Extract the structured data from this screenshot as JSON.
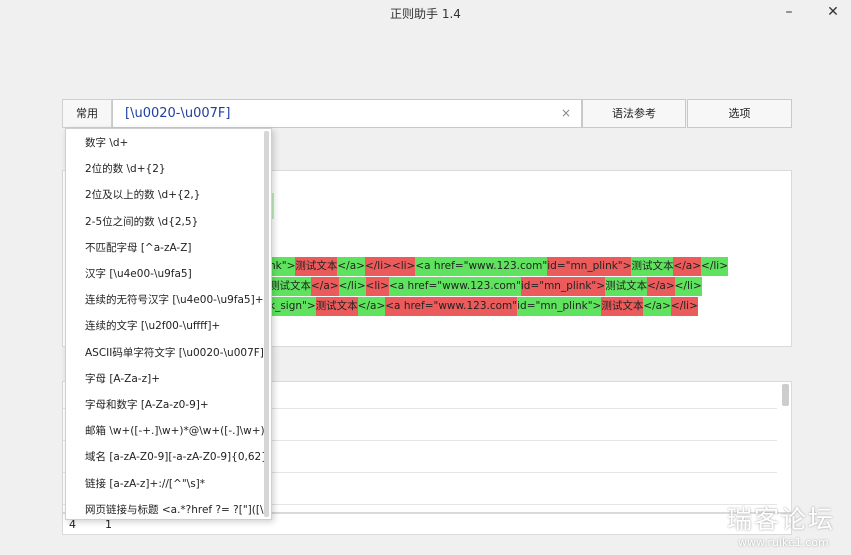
{
  "window": {
    "title": "正则助手 1.4",
    "minimize": "–",
    "close": "✕"
  },
  "toolbar": {
    "common_label": "常用",
    "regex_value": "[\\u0020-\\u007F]",
    "clear": "×",
    "syntax_ref_label": "语法参考",
    "options_label": "选项"
  },
  "highlight_lines": [
    [
      {
        "t": "nk\">",
        "c": "g"
      },
      {
        "t": "测试文本",
        "c": "r"
      },
      {
        "t": "</a>",
        "c": "g"
      },
      {
        "t": "</li>",
        "c": "r"
      },
      {
        "t": "  ",
        "c": "g"
      },
      {
        "t": "<li>",
        "c": "r"
      },
      {
        "t": "<a href=\"www.123.com\"",
        "c": "g"
      },
      {
        "t": " id=\"mn_plink\">",
        "c": "r"
      },
      {
        "t": "测试文本",
        "c": "g"
      },
      {
        "t": "</a>",
        "c": "r"
      },
      {
        "t": "</li>",
        "c": "g"
      }
    ],
    [
      {
        "t": "测试文本",
        "c": "g"
      },
      {
        "t": "</a>",
        "c": "r"
      },
      {
        "t": "</li>",
        "c": "g"
      },
      {
        "t": "<li>",
        "c": "r"
      },
      {
        "t": "<a href=\"www.123.com\"",
        "c": "g"
      },
      {
        "t": " id=\"mn_plink\">",
        "c": "r"
      },
      {
        "t": "测试文本",
        "c": "g"
      },
      {
        "t": "</a>",
        "c": "r"
      },
      {
        "t": "</li>",
        "c": "g"
      }
    ],
    [
      {
        "t": "k_sign\">",
        "c": "g"
      },
      {
        "t": "测试文本",
        "c": "r"
      },
      {
        "t": "</a>",
        "c": "g"
      },
      {
        "t": "<a href=\"www.123.com\"",
        "c": "r"
      },
      {
        "t": " id=\"mn_plink\">",
        "c": "g"
      },
      {
        "t": "测试文本",
        "c": "r"
      },
      {
        "t": "</a>",
        "c": "g"
      },
      {
        "t": "</li>",
        "c": "r"
      }
    ]
  ],
  "dropdown": {
    "items": [
      "数字 \\d+",
      "2位的数 \\d+{2}",
      "2位及以上的数 \\d+{2,}",
      "2-5位之间的数 \\d{2,5}",
      "不匹配字母 [^a-zA-Z]",
      "汉字 [\\u4e00-\\u9fa5]",
      "连续的无符号汉字 [\\u4e00-\\u9fa5]+",
      "连续的文字 [\\u2f00-\\uffff]+",
      "ASCII码单字符文字 [\\u0020-\\u007F]",
      "字母 [A-Za-z]+",
      "字母和数字 [A-Za-z0-9]+",
      "邮箱 \\w+([-+.]\\w+)*@\\w+([-.]\\w+)",
      "域名 [a-zA-Z0-9][-a-zA-Z0-9]{0,62}",
      "链接 [a-zA-z]+://[^\"\\s]*",
      "网页链接与标题 <a.*?href ?= ?[\"]([\\S"
    ]
  },
  "status": {
    "a": "4",
    "b": "1"
  },
  "watermark": {
    "cn": "瑞客论坛",
    "en": "www.ruike1.com"
  }
}
